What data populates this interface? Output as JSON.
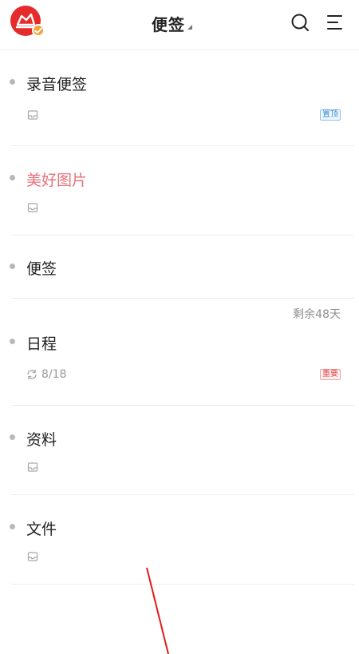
{
  "header": {
    "title": "便签"
  },
  "notes": [
    {
      "title": "录音便签",
      "tag": "置顶"
    },
    {
      "title": "美好图片"
    },
    {
      "title": "便签"
    },
    {
      "title": "日程",
      "remaining": "剩余48天",
      "repeat": "8/18",
      "tag": "重要"
    },
    {
      "title": "资料"
    },
    {
      "title": "文件"
    }
  ],
  "colors": {
    "accent_red": "#e52b2b",
    "pink_title": "#e8707a",
    "tag_blue": "#3b8fd6",
    "tag_red": "#e24646"
  },
  "icons": {
    "avatar": "cloud-logo-icon",
    "badge": "checkmark-badge-icon",
    "search": "search-icon",
    "menu": "menu-icon",
    "attachment": "inbox-tray-icon",
    "repeat": "repeat-icon"
  }
}
